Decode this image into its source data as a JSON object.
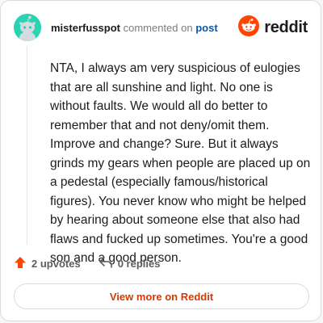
{
  "header": {
    "username": "misterfusspot",
    "action_text": "commented on",
    "post_link": "post"
  },
  "brand": {
    "name": "reddit",
    "icon": "reddit-logo-icon",
    "color": "#ff4500"
  },
  "avatar": {
    "icon": "snoo-avatar-icon",
    "color": "#2ad4b3"
  },
  "comment": {
    "body": "NTA, I always am very suspicious of eulogies that are all sunshine and light. No one is without faults. We would all do better to remember that and not deny/omit them. Improve and change? Sure. But it always grinds my gears when people are placed up on a pedestal (especially famous/historical figures). You never know who might be helped by hearing about someone else that also had flaws and fucked up sometimes. You're a good son and a good person."
  },
  "actions": {
    "upvotes_label": "2 upvotes",
    "upvote_icon": "upvote-arrow-icon",
    "replies_label": "0 replies",
    "reply_icon": "reply-arrow-icon"
  },
  "cta": {
    "label": "View more on Reddit",
    "color": "#d93900"
  }
}
